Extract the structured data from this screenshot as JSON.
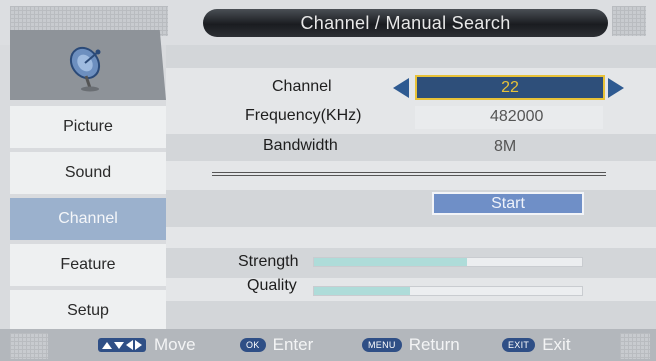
{
  "title": "Channel / Manual Search",
  "sidebar": {
    "icon": "satellite-dish-icon",
    "items": [
      {
        "label": "Picture",
        "active": false
      },
      {
        "label": "Sound",
        "active": false
      },
      {
        "label": "Channel",
        "active": true
      },
      {
        "label": "Feature",
        "active": false
      },
      {
        "label": "Setup",
        "active": false
      }
    ]
  },
  "form": {
    "channel_label": "Channel",
    "channel_value": "22",
    "frequency_label": "Frequency(KHz)",
    "frequency_value": "482000",
    "bandwidth_label": "Bandwidth",
    "bandwidth_value": "8M",
    "start_label": "Start"
  },
  "signal": {
    "strength_label": "Strength",
    "strength_level": 0.57,
    "quality_label": "Quality",
    "quality_level": 0.36
  },
  "footer": {
    "move_key": "arrows-icon",
    "move_label": "Move",
    "enter_key": "OK",
    "enter_label": "Enter",
    "return_key": "MENU",
    "return_label": "Return",
    "exit_key": "EXIT",
    "exit_label": "Exit"
  },
  "colors": {
    "accent": "#2e4f7a",
    "highlight": "#e8c238",
    "active_tab": "#9bb1cd",
    "start_button": "#6f8fc7",
    "signal_bar": "#aedcd9"
  }
}
